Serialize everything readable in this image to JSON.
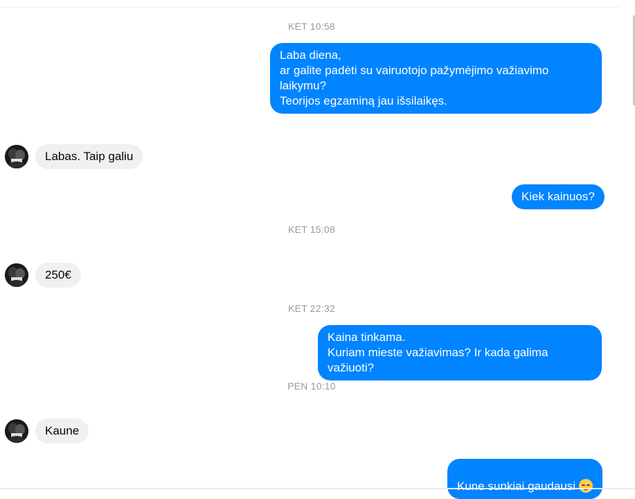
{
  "colors": {
    "outgoing_bubble": "#0084ff",
    "incoming_bubble": "#f1f0f0",
    "timestamp": "#999999"
  },
  "timestamps": [
    "KET 10:58",
    "KET 15:08",
    "KET 22:32",
    "PEN 10:10"
  ],
  "messages": [
    {
      "direction": "outgoing",
      "text": "Laba diena,\nar galite padėti su vairuotojo pažymėjimo važiavimo\nlaikymu?\nTeorijos egzaminą jau išsilaikęs."
    },
    {
      "direction": "incoming",
      "text": "Labas. Taip galiu"
    },
    {
      "direction": "outgoing",
      "text": "Kiek kainuos?"
    },
    {
      "direction": "incoming",
      "text": "250€"
    },
    {
      "direction": "outgoing",
      "text": "Kaina tinkama.\nKuriam mieste važiavimas? Ir kada galima važiuoti?"
    },
    {
      "direction": "incoming",
      "text": "Kaune"
    },
    {
      "direction": "outgoing",
      "text": "Kune sunkiai gaudausi",
      "emoji": "disappointed-face"
    }
  ]
}
